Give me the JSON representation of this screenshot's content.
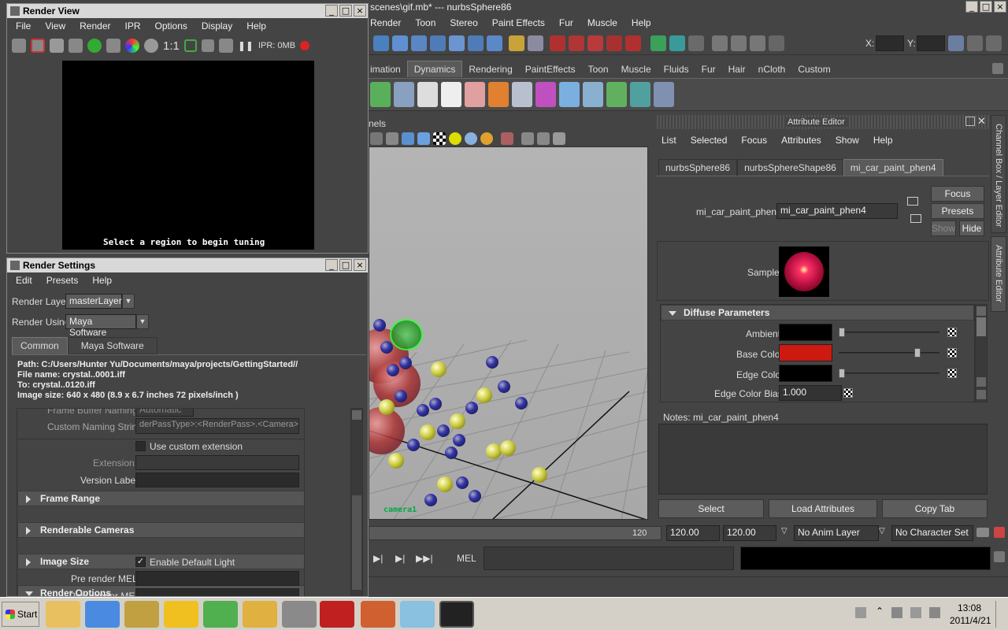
{
  "maya": {
    "title": "scenes\\gif.mb*  ---  nurbsSphere86",
    "menu": [
      "Render",
      "Toon",
      "Stereo",
      "Paint Effects",
      "Fur",
      "Muscle",
      "Help"
    ],
    "status": {
      "x_label": "X:",
      "y_label": "Y:"
    },
    "shelf_tabs": [
      "imation",
      "Dynamics",
      "Rendering",
      "PaintEffects",
      "Toon",
      "Muscle",
      "Fluids",
      "Fur",
      "Hair",
      "nCloth",
      "Custom"
    ],
    "active_shelf": "Dynamics",
    "panel_menu_label": "nels",
    "camera_label": "camera1"
  },
  "attr_editor": {
    "title": "Attribute Editor",
    "menu": [
      "List",
      "Selected",
      "Focus",
      "Attributes",
      "Show",
      "Help"
    ],
    "tabs": [
      "nurbsSphere86",
      "nurbsSphereShape86",
      "mi_car_paint_phen4"
    ],
    "active_tab": "mi_car_paint_phen4",
    "node_label": "mi_car_paint_phen:",
    "node_value": "mi_car_paint_phen4",
    "focus_btn": "Focus",
    "presets_btn": "Presets",
    "show_btn": "Show",
    "hide_btn": "Hide",
    "sample_label": "Sample",
    "section": "Diffuse Parameters",
    "ambient_label": "Ambient",
    "base_color_label": "Base Color",
    "edge_color_label": "Edge Color",
    "edge_bias_label": "Edge Color Bias",
    "edge_bias_value": "1.000",
    "notes_label": "Notes:  mi_car_paint_phen4",
    "select_btn": "Select",
    "load_btn": "Load Attributes",
    "copy_btn": "Copy Tab",
    "side_tabs": [
      "Channel Box / Layer Editor",
      "Attribute Editor"
    ],
    "colors": {
      "ambient": "#000000",
      "base": "#cc1a10",
      "edge": "#000000"
    }
  },
  "timeline": {
    "end_frame": "120",
    "field1": "120.00",
    "field2": "120.00",
    "anim_layer": "No Anim Layer",
    "char_set": "No Character Set",
    "mel_label": "MEL"
  },
  "render_view": {
    "title": "Render View",
    "menu": [
      "File",
      "View",
      "Render",
      "IPR",
      "Options",
      "Display",
      "Help"
    ],
    "ratio": "1:1",
    "ipr": "IPR: 0MB",
    "message": "Select a region to begin tuning"
  },
  "render_settings": {
    "title": "Render Settings",
    "menu": [
      "Edit",
      "Presets",
      "Help"
    ],
    "render_layer_label": "Render Layer",
    "render_layer_value": "masterLayer",
    "render_using_label": "Render Using",
    "render_using_value": "Maya Software",
    "tabs": [
      "Common",
      "Maya Software"
    ],
    "path": "Path: C:/Users/Hunter Yu/Documents/maya/projects/GettingStarted//",
    "file_name": "File name:  crystal..0001.iff",
    "to": "To:            crystal..0120.iff",
    "image_size": "Image size: 640 x 480 (8.9 x 6.7 inches 72 pixels/inch )",
    "frame_buffer_label": "Frame Buffer Naming:",
    "frame_buffer_value": "Automatic",
    "custom_naming_label": "Custom Naming String:",
    "custom_naming_value": "derPassType>:<RenderPass>.<Camera>",
    "use_custom_ext": "Use custom extension",
    "extension_label": "Extension:",
    "version_label": "Version Label:",
    "sections": [
      "Frame Range",
      "Renderable Cameras",
      "Image Size",
      "Render Options"
    ],
    "enable_default_light": "Enable Default Light",
    "pre_render_label": "Pre render MEL:",
    "post_render_label": "Post render MEL:"
  },
  "taskbar": {
    "start": "Start",
    "time": "13:08",
    "date": "2011/4/21"
  }
}
